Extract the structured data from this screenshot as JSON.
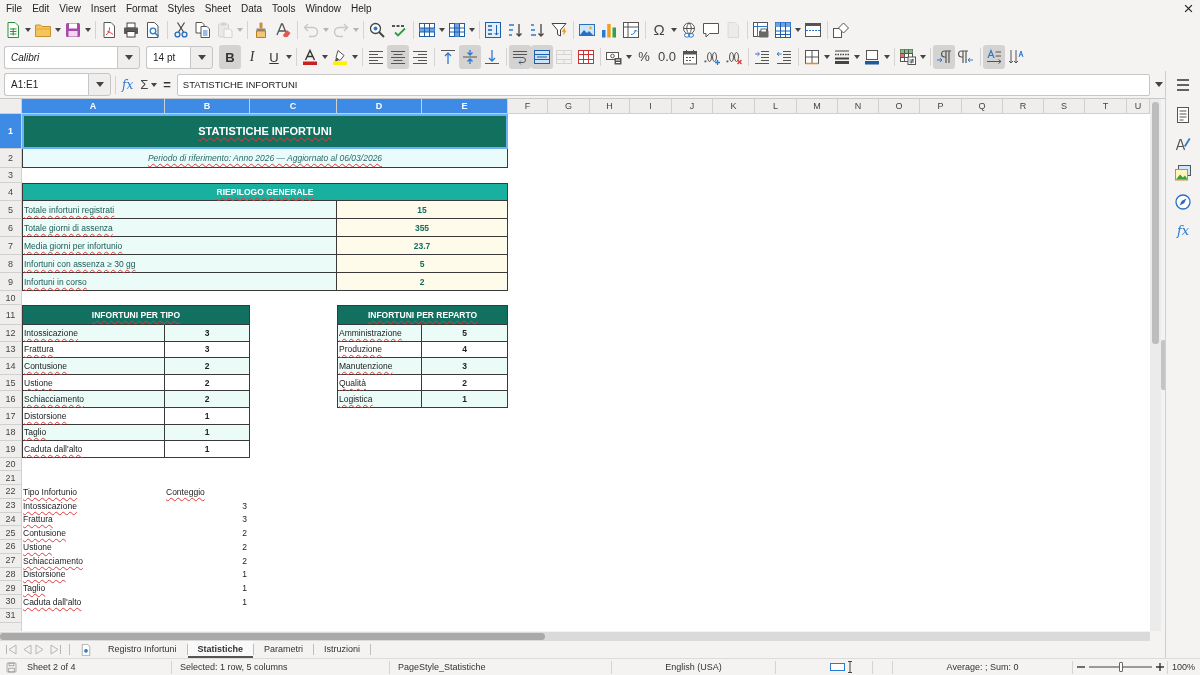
{
  "menu_bar": [
    "File",
    "Edit",
    "View",
    "Insert",
    "Format",
    "Styles",
    "Sheet",
    "Data",
    "Tools",
    "Window",
    "Help"
  ],
  "standard_toolbar": {
    "special_character": "Ω",
    "paste_disabled": true,
    "undo_disabled": true,
    "redo_disabled": true,
    "header_footer_disabled": true
  },
  "formatting_toolbar": {
    "font_name": "Calibri",
    "font_size": "14 pt",
    "bold": {
      "label": "B",
      "on": true
    },
    "italic": {
      "label": "I",
      "on": false
    },
    "underline": {
      "label": "U",
      "on": false
    },
    "align_left": false,
    "align_center": true,
    "align_right": false,
    "align_top": false,
    "align_middle": true,
    "align_bottom": false,
    "wrap_text": true,
    "merge_and_center": true,
    "merge_cells_disabled": true,
    "percent": "%",
    "number": "0.0",
    "left_to_right": true,
    "right_to_left": false,
    "text_horizontal": true,
    "text_vertical": false
  },
  "formula_bar": {
    "name_box": "A1:E1",
    "function_wizard": "fx",
    "sum": "Σ",
    "equals": "=",
    "content": "STATISTICHE INFORTUNI"
  },
  "sidebar": {
    "functions": "fx"
  },
  "sheet": {
    "columns": [
      {
        "label": "A",
        "selected": true
      },
      {
        "label": "B",
        "selected": true
      },
      {
        "label": "C",
        "selected": true
      },
      {
        "label": "D",
        "selected": true
      },
      {
        "label": "E",
        "selected": true
      },
      {
        "label": "F",
        "selected": false
      },
      {
        "label": "G",
        "selected": false
      },
      {
        "label": "H",
        "selected": false
      },
      {
        "label": "I",
        "selected": false
      },
      {
        "label": "J",
        "selected": false
      },
      {
        "label": "K",
        "selected": false
      },
      {
        "label": "L",
        "selected": false
      },
      {
        "label": "M",
        "selected": false
      },
      {
        "label": "N",
        "selected": false
      },
      {
        "label": "O",
        "selected": false
      },
      {
        "label": "P",
        "selected": false
      },
      {
        "label": "Q",
        "selected": false
      },
      {
        "label": "R",
        "selected": false
      },
      {
        "label": "S",
        "selected": false
      },
      {
        "label": "T",
        "selected": false
      },
      {
        "label": "U",
        "selected": false
      }
    ],
    "rows": [
      {
        "label": "1",
        "selected": true
      },
      {
        "label": "2",
        "selected": false
      },
      {
        "label": "3",
        "selected": false
      },
      {
        "label": "4",
        "selected": false
      },
      {
        "label": "5",
        "selected": false
      },
      {
        "label": "6",
        "selected": false
      },
      {
        "label": "7",
        "selected": false
      },
      {
        "label": "8",
        "selected": false
      },
      {
        "label": "9",
        "selected": false
      },
      {
        "label": "10",
        "selected": false
      },
      {
        "label": "11",
        "selected": false
      },
      {
        "label": "12",
        "selected": false
      },
      {
        "label": "13",
        "selected": false
      },
      {
        "label": "14",
        "selected": false
      },
      {
        "label": "15",
        "selected": false
      },
      {
        "label": "16",
        "selected": false
      },
      {
        "label": "17",
        "selected": false
      },
      {
        "label": "18",
        "selected": false
      },
      {
        "label": "19",
        "selected": false
      },
      {
        "label": "20",
        "selected": false
      },
      {
        "label": "21",
        "selected": false
      },
      {
        "label": "22",
        "selected": false
      },
      {
        "label": "23",
        "selected": false
      },
      {
        "label": "24",
        "selected": false
      },
      {
        "label": "25",
        "selected": false
      },
      {
        "label": "26",
        "selected": false
      },
      {
        "label": "27",
        "selected": false
      },
      {
        "label": "28",
        "selected": false
      },
      {
        "label": "29",
        "selected": false
      },
      {
        "label": "30",
        "selected": false
      },
      {
        "label": "31",
        "selected": false
      }
    ],
    "title": {
      "text": "STATISTICHE INFORTUNI",
      "selected": true
    },
    "subtitle": "Periodo di riferimento: Anno 2026 — Aggiornato al 06/03/2026",
    "summary": {
      "title": "RIEPILOGO GENERALE",
      "rows": [
        {
          "label": "Totale infortuni registrati",
          "value": "15"
        },
        {
          "label": "Totale giorni di assenza",
          "value": "355"
        },
        {
          "label": "Media giorni per infortunio",
          "value": "23.7"
        },
        {
          "label": "Infortuni con assenza ≥ 30 gg",
          "value": "5"
        },
        {
          "label": "Infortuni in corso",
          "value": "2"
        }
      ]
    },
    "by_type": {
      "title": "INFORTUNI PER TIPO",
      "rows": [
        {
          "label": "Intossicazione",
          "value": "3"
        },
        {
          "label": "Frattura",
          "value": "3"
        },
        {
          "label": "Contusione",
          "value": "2"
        },
        {
          "label": "Ustione",
          "value": "2"
        },
        {
          "label": "Schiacciamento",
          "value": "2"
        },
        {
          "label": "Distorsione",
          "value": "1"
        },
        {
          "label": "Taglio",
          "value": "1"
        },
        {
          "label": "Caduta dall'alto",
          "value": "1"
        }
      ]
    },
    "by_department": {
      "title": "INFORTUNI PER REPARTO",
      "rows": [
        {
          "label": "Amministrazione",
          "value": "5"
        },
        {
          "label": "Produzione",
          "value": "4"
        },
        {
          "label": "Manutenzione",
          "value": "3"
        },
        {
          "label": "Qualità",
          "value": "2"
        },
        {
          "label": "Logistica",
          "value": "1"
        }
      ]
    },
    "data_list": {
      "headers": [
        "Tipo Infortunio",
        "Conteggio"
      ],
      "rows": [
        {
          "label": "Intossicazione",
          "value": "3"
        },
        {
          "label": "Frattura",
          "value": "3"
        },
        {
          "label": "Contusione",
          "value": "2"
        },
        {
          "label": "Ustione",
          "value": "2"
        },
        {
          "label": "Schiacciamento",
          "value": "2"
        },
        {
          "label": "Distorsione",
          "value": "1"
        },
        {
          "label": "Taglio",
          "value": "1"
        },
        {
          "label": "Caduta dall'alto",
          "value": "1"
        }
      ]
    }
  },
  "sheet_tabs": {
    "navigation_disabled": true,
    "tabs": [
      {
        "label": "Registro Infortuni",
        "selected": false
      },
      {
        "label": "Statistiche",
        "selected": true
      },
      {
        "label": "Parametri",
        "selected": false
      },
      {
        "label": "Istruzioni",
        "selected": false
      }
    ]
  },
  "status_bar": {
    "sheet": "Sheet 2 of 4",
    "selection": "Selected: 1 row, 5 columns",
    "page_style": "PageStyle_Statistiche",
    "language": "English (USA)",
    "summary": "Average: ; Sum: 0",
    "zoom": {
      "level": 0.5,
      "label": "100%"
    }
  }
}
